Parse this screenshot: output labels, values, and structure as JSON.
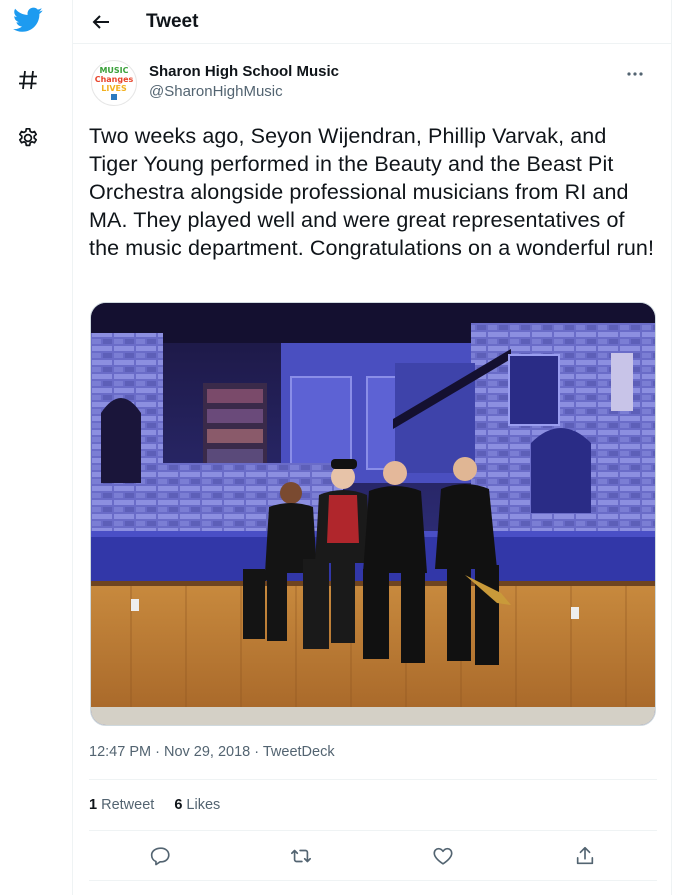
{
  "nav": {
    "icons": [
      "twitter-bird-icon",
      "explore-hashtag-icon",
      "settings-gear-icon"
    ],
    "brand_color": "#1d9bf0"
  },
  "header": {
    "title": "Tweet"
  },
  "author": {
    "name": "Sharon High School Music",
    "handle": "@SharonHighMusic",
    "avatar_text": [
      "MUSIC",
      "Changes",
      "LIVES"
    ]
  },
  "tweet": {
    "text": "Two weeks ago, Seyon Wijendran, Phillip Varvak, and Tiger Young performed in the Beauty and the Beast Pit Orchestra alongside professional musicians from RI and MA. They played well and were great representatives of the music department. Congratulations on a wonderful run!",
    "time": "12:47 PM",
    "date": "Nov 29, 2018",
    "source": "TweetDeck"
  },
  "stats": {
    "retweets_count": "1",
    "retweets_label": "Retweet",
    "likes_count": "6",
    "likes_label": "Likes"
  },
  "colors": {
    "text_primary": "#0f1419",
    "text_secondary": "#536471",
    "divider": "#eff3f4"
  }
}
